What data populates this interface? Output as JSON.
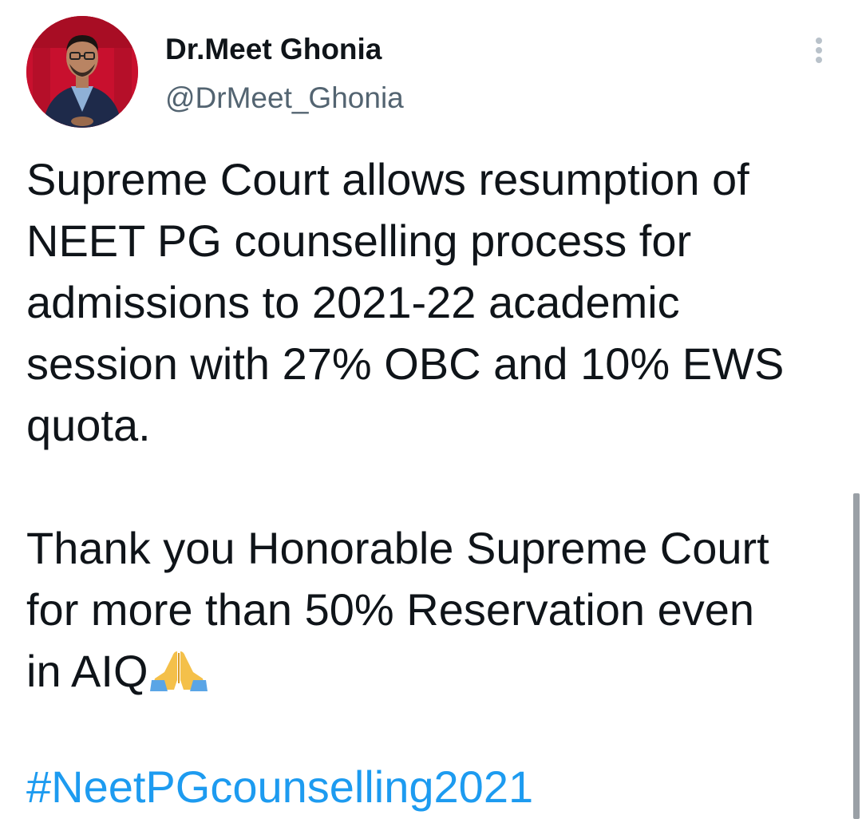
{
  "tweet": {
    "author": {
      "display_name": "Dr.Meet Ghonia",
      "handle": "@DrMeet_Ghonia"
    },
    "more_icon": "vertical-ellipsis-icon",
    "text": {
      "paragraph1_lines": [
        "Supreme Court allows resumption of",
        "NEET PG counselling process for",
        "admissions to 2021-22 academic",
        "session with 27% OBC and 10% EWS",
        "quota."
      ],
      "paragraph2_lines": [
        "Thank you Honorable Supreme Court",
        "for more than 50% Reservation even",
        "in AIQ"
      ],
      "emoji": "folded-hands-emoji"
    },
    "hashtag": "#NeetPGcounselling2021"
  },
  "colors": {
    "text_primary": "#0f1419",
    "text_secondary": "#536471",
    "link": "#1d9bf0",
    "avatar_background": "#c8102e"
  }
}
